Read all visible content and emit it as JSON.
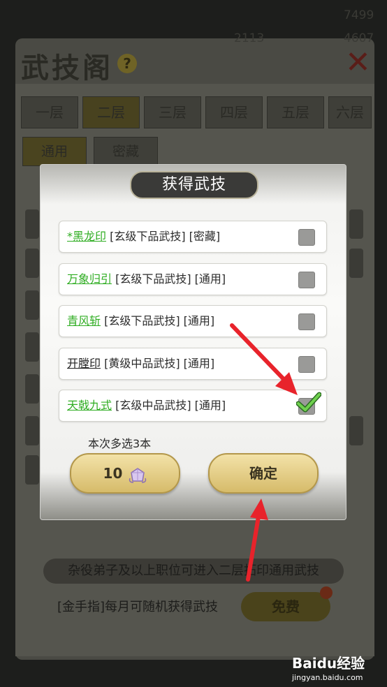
{
  "background": {
    "title": "武技阁",
    "help": "?",
    "top_texts": [
      "7499",
      "2113",
      "4607"
    ],
    "floors": [
      "一层",
      "二层",
      "三层",
      "四层",
      "五层",
      "六层"
    ],
    "sub_tabs": [
      "通用",
      "密藏"
    ],
    "notice": "杂役弟子及以上职位可进入二层拓印通用武技",
    "monthly": "[金手指]每月可随机获得武技",
    "free_button": "免费"
  },
  "dialog": {
    "title": "获得武技",
    "items": [
      {
        "name": "*黑龙印",
        "desc": " [玄级下品武技] [密藏]",
        "name_color": "green",
        "checked": false
      },
      {
        "name": "万象归引",
        "desc": " [玄级下品武技] [通用]",
        "name_color": "green",
        "checked": false
      },
      {
        "name": "青风斩",
        "desc": " [玄级下品武技] [通用]",
        "name_color": "green",
        "checked": false
      },
      {
        "name": "开膛印",
        "desc": " [黄级中品武技] [通用]",
        "name_color": "dark",
        "checked": false
      },
      {
        "name": "天戟九式",
        "desc": " [玄级中品武技] [通用]",
        "name_color": "green",
        "checked": true
      }
    ],
    "hint": "本次多选3本",
    "cost_button": {
      "value": "10",
      "icon": "spirit-gem-icon"
    },
    "confirm_button": "确定"
  },
  "watermark": {
    "logo": "Baidu经验",
    "url": "jingyan.baidu.com"
  },
  "colors": {
    "accent_green": "#2fad22",
    "button_gold": "#e6cf86",
    "arrow_red": "#e8232b"
  }
}
